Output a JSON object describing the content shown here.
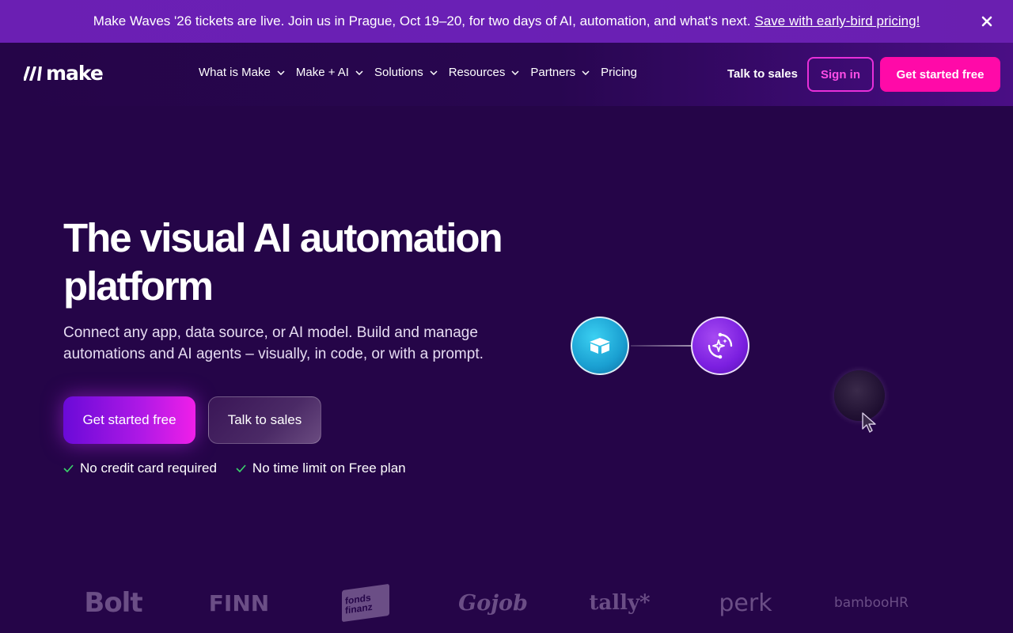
{
  "banner": {
    "text": "Make Waves '26 tickets are live. Join us in Prague, Oct 19–20, for two days of AI, automation, and what's next.",
    "link": "Save with early-bird pricing!",
    "close_icon": "close-icon"
  },
  "header": {
    "logo_text": "make",
    "nav": [
      {
        "label": "What is Make",
        "has_dropdown": true
      },
      {
        "label": "Make + AI",
        "has_dropdown": true
      },
      {
        "label": "Solutions",
        "has_dropdown": true
      },
      {
        "label": "Resources",
        "has_dropdown": true
      },
      {
        "label": "Partners",
        "has_dropdown": true
      },
      {
        "label": "Pricing",
        "has_dropdown": false
      }
    ],
    "talk_to_sales": "Talk to sales",
    "sign_in": "Sign in",
    "get_started": "Get started free"
  },
  "hero": {
    "title_line1": "The visual AI automation",
    "title_line2": "platform",
    "subtitle_line1": "Connect any app, data source, or AI model. Build and manage",
    "subtitle_line2": "automations and AI agents – visually, in code, or with a prompt.",
    "primary_button": "Get started free",
    "secondary_button": "Talk to sales",
    "checks": [
      "No credit card required",
      "No time limit on Free plan"
    ]
  },
  "illustration": {
    "nodes": [
      "cube-app-icon",
      "ai-sparkle-icon"
    ],
    "cursor_icon": "cursor-icon"
  },
  "logos": [
    "Bolt",
    "FINN",
    "fonds finanz",
    "Gojob",
    "tally*",
    "perk",
    "bambooHR"
  ],
  "colors": {
    "background": "#250548",
    "banner": "#6a20b5",
    "accent_pink": "#ff0aa8",
    "sign_in_border": "#e82fd9",
    "check_green": "#3ad46b"
  }
}
